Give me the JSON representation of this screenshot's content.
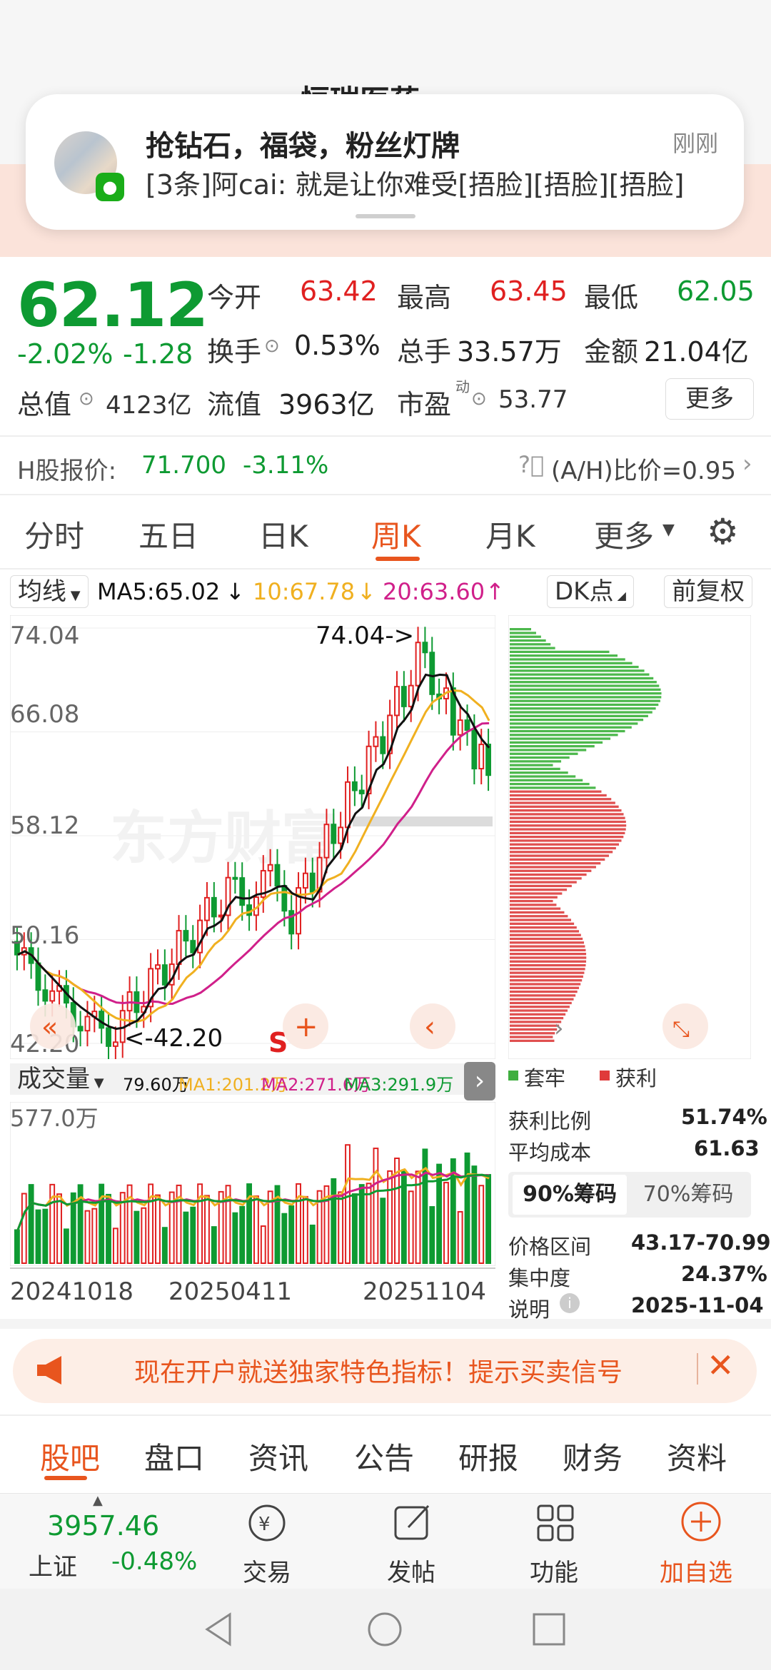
{
  "header": {
    "title_partial": "恒瑞医药"
  },
  "notification": {
    "title": "抢钻石，福袋，粉丝灯牌",
    "time": "刚刚",
    "body": "[3条]阿cai: 就是让你难受[捂脸][捂脸][捂脸]",
    "app_icon": "wechat-icon"
  },
  "quote": {
    "price": "62.12",
    "change_pct": "-2.02%",
    "change_abs": "-1.28",
    "open_label": "今开",
    "open": "63.42",
    "high_label": "最高",
    "high": "63.45",
    "low_label": "最低",
    "low": "62.05",
    "turnover_label": "换手",
    "turnover": "0.53%",
    "volume_label": "总手",
    "volume": "33.57万",
    "amount_label": "金额",
    "amount": "21.04亿",
    "mktcap_label": "总值",
    "mktcap": "4123亿",
    "float_label": "流值",
    "float": "3963亿",
    "pe_label": "市盈",
    "pe_sup": "动",
    "pe": "53.77",
    "more": "更多"
  },
  "hshare": {
    "label": "H股报价:",
    "price": "71.700",
    "change": "-3.11%",
    "ah_label": "(A/H)比价=0.95"
  },
  "tabs": [
    "分时",
    "五日",
    "日K",
    "周K",
    "月K",
    "更多"
  ],
  "active_tab": "周K",
  "ma_legend": {
    "selector": "均线",
    "ma5": "MA5:65.02",
    "ma10": "10:67.78",
    "ma20": "20:63.60",
    "dk": "DK点",
    "adjust": "前复权"
  },
  "colors": {
    "up": "#e02020",
    "down": "#0e9a32",
    "accent": "#e8551e",
    "ma5": "#111111",
    "ma10": "#f0b020",
    "ma20": "#d0208a"
  },
  "kline": {
    "y_ticks": [
      "74.04",
      "66.08",
      "58.12",
      "50.16",
      "42.20"
    ],
    "max_label": "74.04->",
    "min_label": "<-42.20",
    "watermark": "东方财富",
    "s_marker": "S"
  },
  "volume": {
    "selector": "成交量",
    "vol": "79.60万",
    "ma1": "MA1:201.2万",
    "ma2": "MA2:271.6万",
    "ma3": "MA3:291.9万",
    "max": "577.0万"
  },
  "dates": [
    "20241018",
    "20250411",
    "20251104"
  ],
  "chip": {
    "legend_trapped": "套牢",
    "legend_profit": "获利",
    "profit_ratio_label": "获利比例",
    "profit_ratio": "51.74%",
    "avg_cost_label": "平均成本",
    "avg_cost": "61.63",
    "tab90": "90%筹码",
    "tab70": "70%筹码",
    "range_label": "价格区间",
    "range": "43.17-70.99",
    "conc_label": "集中度",
    "conc": "24.37%",
    "note_label": "说明",
    "note": "2025-11-04"
  },
  "banner": {
    "text": "现在开户就送独家特色指标！提示买卖信号"
  },
  "bottom_tabs": [
    "股吧",
    "盘口",
    "资讯",
    "公告",
    "研报",
    "财务",
    "资料"
  ],
  "index": {
    "value": "3957.46",
    "name": "上证",
    "change": "-0.48%"
  },
  "nav": [
    "交易",
    "发帖",
    "功能",
    "加自选"
  ],
  "chart_data": {
    "type": "candlestick",
    "y_axis": [
      42.2,
      74.04
    ],
    "series": [
      {
        "name": "MA5",
        "value": 65.02
      },
      {
        "name": "MA10",
        "value": 67.78
      },
      {
        "name": "MA20",
        "value": 63.6
      }
    ],
    "dates": [
      "20241018",
      "20250411",
      "20251104"
    ],
    "high": 74.04,
    "low": 42.2
  }
}
